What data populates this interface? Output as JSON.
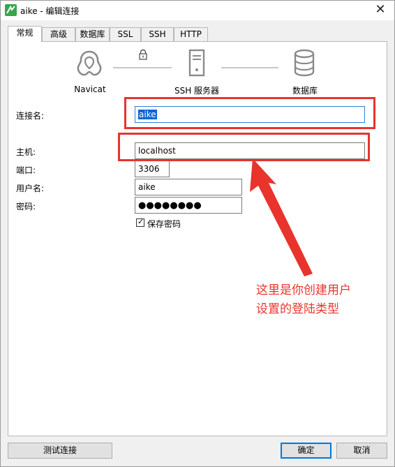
{
  "window": {
    "title": "aike - 编辑连接",
    "close_glyph": "✕"
  },
  "tabs": [
    {
      "label": "常规",
      "active": true
    },
    {
      "label": "高级"
    },
    {
      "label": "数据库"
    },
    {
      "label": "SSL"
    },
    {
      "label": "SSH"
    },
    {
      "label": "HTTP"
    }
  ],
  "flow": {
    "navicat_label": "Navicat",
    "ssh_label": "SSH 服务器",
    "db_label": "数据库",
    "icons": [
      "navicat-logo-icon",
      "lock-icon",
      "server-icon",
      "database-icon"
    ]
  },
  "form": {
    "conn_name_label": "连接名:",
    "conn_name_value": "aike",
    "host_label": "主机:",
    "host_value": "localhost",
    "port_label": "端口:",
    "port_value": "3306",
    "user_label": "用户名:",
    "user_value": "aike",
    "password_label": "密码:",
    "password_value": "●●●●●●●●",
    "save_password_label": "保存密码",
    "save_password_checked": true
  },
  "annotation": {
    "line1": "这里是你创建用户",
    "line2": "设置的登陆类型",
    "color": "#e8342c"
  },
  "buttons": {
    "test_label": "测试连接",
    "ok_label": "确定",
    "cancel_label": "取消"
  }
}
